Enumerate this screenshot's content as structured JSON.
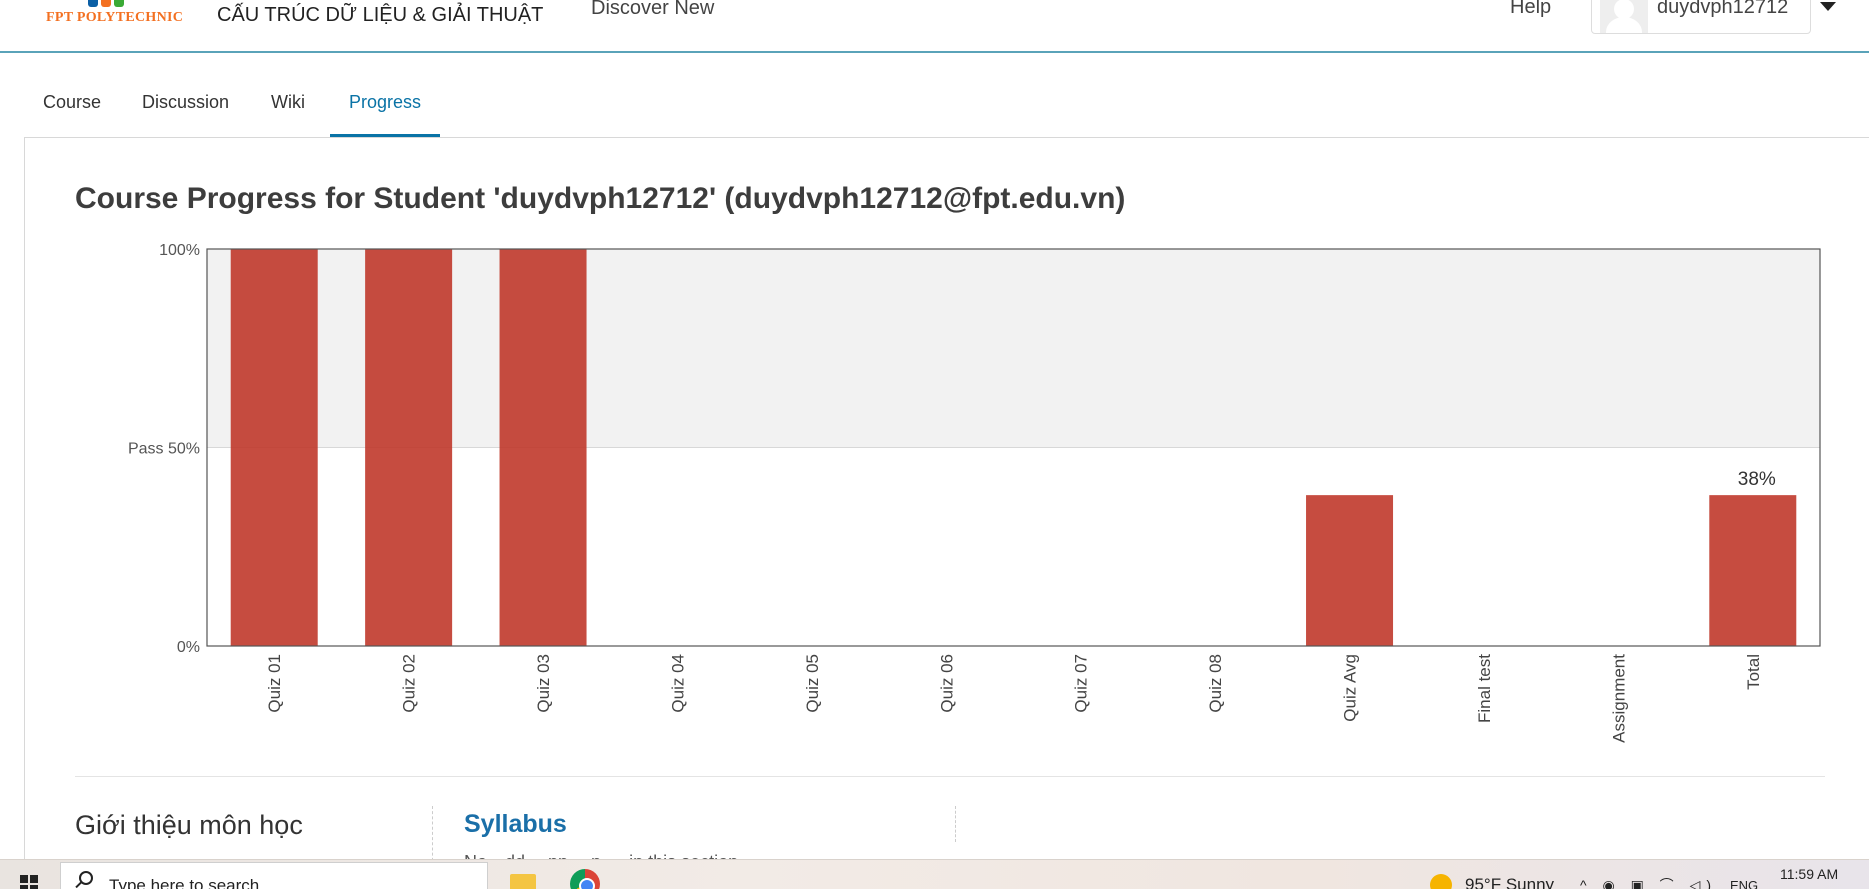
{
  "header": {
    "logo_text": "FPT POLYTECHNIC",
    "course_title": "CẤU TRÚC DỮ LIỆU & GIẢI THUẬT",
    "discover": "Discover New",
    "help": "Help",
    "username": "duydvph12712"
  },
  "tabs": [
    {
      "label": "Course",
      "active": false
    },
    {
      "label": "Discussion",
      "active": false
    },
    {
      "label": "Wiki",
      "active": false
    },
    {
      "label": "Progress",
      "active": true
    }
  ],
  "page_title": "Course Progress for Student 'duydvph12712' (duydvph12712@fpt.edu.vn)",
  "chart_data": {
    "type": "bar",
    "categories": [
      "Quiz 01",
      "Quiz 02",
      "Quiz 03",
      "Quiz 04",
      "Quiz 05",
      "Quiz 06",
      "Quiz 07",
      "Quiz 08",
      "Quiz Avg",
      "Final test",
      "Assignment",
      "Total"
    ],
    "values": [
      100,
      100,
      100,
      0,
      0,
      0,
      0,
      0,
      38,
      0,
      0,
      38
    ],
    "ylim": [
      0,
      100
    ],
    "yticks": [
      {
        "value": 0,
        "label": "0%"
      },
      {
        "value": 50,
        "label": "Pass 50%"
      },
      {
        "value": 100,
        "label": "100%"
      }
    ],
    "data_labels": [
      {
        "category": "Total",
        "label": "38%"
      }
    ],
    "bar_color": "#c0392b",
    "pass_band_color": "#f2f2f2",
    "grid": false
  },
  "sections": {
    "intro_title": "Giới thiệu môn học",
    "syllabus_title": "Syllabus",
    "syllabus_text": "No…dd… nn …n … in this section"
  },
  "taskbar": {
    "search_placeholder": "Type here to search",
    "weather": "95°F  Sunny",
    "language": "ENG",
    "time": "11:59 AM"
  }
}
